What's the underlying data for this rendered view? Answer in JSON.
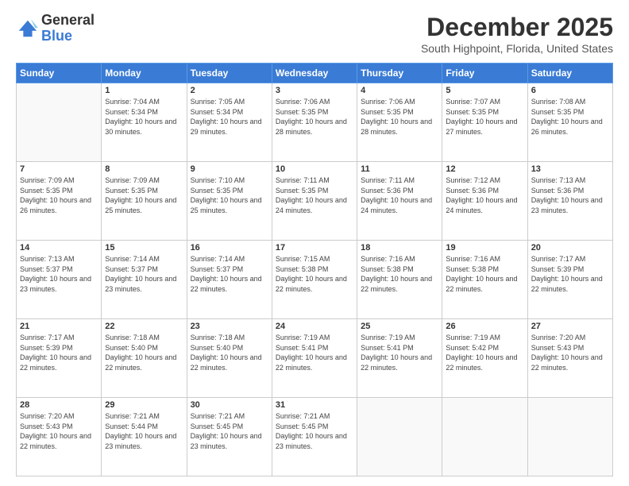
{
  "logo": {
    "line1": "General",
    "line2": "Blue"
  },
  "title": "December 2025",
  "location": "South Highpoint, Florida, United States",
  "header": {
    "days": [
      "Sunday",
      "Monday",
      "Tuesday",
      "Wednesday",
      "Thursday",
      "Friday",
      "Saturday"
    ]
  },
  "weeks": [
    [
      {
        "day": "",
        "sunrise": "",
        "sunset": "",
        "daylight": ""
      },
      {
        "day": "1",
        "sunrise": "Sunrise: 7:04 AM",
        "sunset": "Sunset: 5:34 PM",
        "daylight": "Daylight: 10 hours and 30 minutes."
      },
      {
        "day": "2",
        "sunrise": "Sunrise: 7:05 AM",
        "sunset": "Sunset: 5:34 PM",
        "daylight": "Daylight: 10 hours and 29 minutes."
      },
      {
        "day": "3",
        "sunrise": "Sunrise: 7:06 AM",
        "sunset": "Sunset: 5:35 PM",
        "daylight": "Daylight: 10 hours and 28 minutes."
      },
      {
        "day": "4",
        "sunrise": "Sunrise: 7:06 AM",
        "sunset": "Sunset: 5:35 PM",
        "daylight": "Daylight: 10 hours and 28 minutes."
      },
      {
        "day": "5",
        "sunrise": "Sunrise: 7:07 AM",
        "sunset": "Sunset: 5:35 PM",
        "daylight": "Daylight: 10 hours and 27 minutes."
      },
      {
        "day": "6",
        "sunrise": "Sunrise: 7:08 AM",
        "sunset": "Sunset: 5:35 PM",
        "daylight": "Daylight: 10 hours and 26 minutes."
      }
    ],
    [
      {
        "day": "7",
        "sunrise": "Sunrise: 7:09 AM",
        "sunset": "Sunset: 5:35 PM",
        "daylight": "Daylight: 10 hours and 26 minutes."
      },
      {
        "day": "8",
        "sunrise": "Sunrise: 7:09 AM",
        "sunset": "Sunset: 5:35 PM",
        "daylight": "Daylight: 10 hours and 25 minutes."
      },
      {
        "day": "9",
        "sunrise": "Sunrise: 7:10 AM",
        "sunset": "Sunset: 5:35 PM",
        "daylight": "Daylight: 10 hours and 25 minutes."
      },
      {
        "day": "10",
        "sunrise": "Sunrise: 7:11 AM",
        "sunset": "Sunset: 5:35 PM",
        "daylight": "Daylight: 10 hours and 24 minutes."
      },
      {
        "day": "11",
        "sunrise": "Sunrise: 7:11 AM",
        "sunset": "Sunset: 5:36 PM",
        "daylight": "Daylight: 10 hours and 24 minutes."
      },
      {
        "day": "12",
        "sunrise": "Sunrise: 7:12 AM",
        "sunset": "Sunset: 5:36 PM",
        "daylight": "Daylight: 10 hours and 24 minutes."
      },
      {
        "day": "13",
        "sunrise": "Sunrise: 7:13 AM",
        "sunset": "Sunset: 5:36 PM",
        "daylight": "Daylight: 10 hours and 23 minutes."
      }
    ],
    [
      {
        "day": "14",
        "sunrise": "Sunrise: 7:13 AM",
        "sunset": "Sunset: 5:37 PM",
        "daylight": "Daylight: 10 hours and 23 minutes."
      },
      {
        "day": "15",
        "sunrise": "Sunrise: 7:14 AM",
        "sunset": "Sunset: 5:37 PM",
        "daylight": "Daylight: 10 hours and 23 minutes."
      },
      {
        "day": "16",
        "sunrise": "Sunrise: 7:14 AM",
        "sunset": "Sunset: 5:37 PM",
        "daylight": "Daylight: 10 hours and 22 minutes."
      },
      {
        "day": "17",
        "sunrise": "Sunrise: 7:15 AM",
        "sunset": "Sunset: 5:38 PM",
        "daylight": "Daylight: 10 hours and 22 minutes."
      },
      {
        "day": "18",
        "sunrise": "Sunrise: 7:16 AM",
        "sunset": "Sunset: 5:38 PM",
        "daylight": "Daylight: 10 hours and 22 minutes."
      },
      {
        "day": "19",
        "sunrise": "Sunrise: 7:16 AM",
        "sunset": "Sunset: 5:38 PM",
        "daylight": "Daylight: 10 hours and 22 minutes."
      },
      {
        "day": "20",
        "sunrise": "Sunrise: 7:17 AM",
        "sunset": "Sunset: 5:39 PM",
        "daylight": "Daylight: 10 hours and 22 minutes."
      }
    ],
    [
      {
        "day": "21",
        "sunrise": "Sunrise: 7:17 AM",
        "sunset": "Sunset: 5:39 PM",
        "daylight": "Daylight: 10 hours and 22 minutes."
      },
      {
        "day": "22",
        "sunrise": "Sunrise: 7:18 AM",
        "sunset": "Sunset: 5:40 PM",
        "daylight": "Daylight: 10 hours and 22 minutes."
      },
      {
        "day": "23",
        "sunrise": "Sunrise: 7:18 AM",
        "sunset": "Sunset: 5:40 PM",
        "daylight": "Daylight: 10 hours and 22 minutes."
      },
      {
        "day": "24",
        "sunrise": "Sunrise: 7:19 AM",
        "sunset": "Sunset: 5:41 PM",
        "daylight": "Daylight: 10 hours and 22 minutes."
      },
      {
        "day": "25",
        "sunrise": "Sunrise: 7:19 AM",
        "sunset": "Sunset: 5:41 PM",
        "daylight": "Daylight: 10 hours and 22 minutes."
      },
      {
        "day": "26",
        "sunrise": "Sunrise: 7:19 AM",
        "sunset": "Sunset: 5:42 PM",
        "daylight": "Daylight: 10 hours and 22 minutes."
      },
      {
        "day": "27",
        "sunrise": "Sunrise: 7:20 AM",
        "sunset": "Sunset: 5:43 PM",
        "daylight": "Daylight: 10 hours and 22 minutes."
      }
    ],
    [
      {
        "day": "28",
        "sunrise": "Sunrise: 7:20 AM",
        "sunset": "Sunset: 5:43 PM",
        "daylight": "Daylight: 10 hours and 22 minutes."
      },
      {
        "day": "29",
        "sunrise": "Sunrise: 7:21 AM",
        "sunset": "Sunset: 5:44 PM",
        "daylight": "Daylight: 10 hours and 23 minutes."
      },
      {
        "day": "30",
        "sunrise": "Sunrise: 7:21 AM",
        "sunset": "Sunset: 5:45 PM",
        "daylight": "Daylight: 10 hours and 23 minutes."
      },
      {
        "day": "31",
        "sunrise": "Sunrise: 7:21 AM",
        "sunset": "Sunset: 5:45 PM",
        "daylight": "Daylight: 10 hours and 23 minutes."
      },
      {
        "day": "",
        "sunrise": "",
        "sunset": "",
        "daylight": ""
      },
      {
        "day": "",
        "sunrise": "",
        "sunset": "",
        "daylight": ""
      },
      {
        "day": "",
        "sunrise": "",
        "sunset": "",
        "daylight": ""
      }
    ]
  ]
}
